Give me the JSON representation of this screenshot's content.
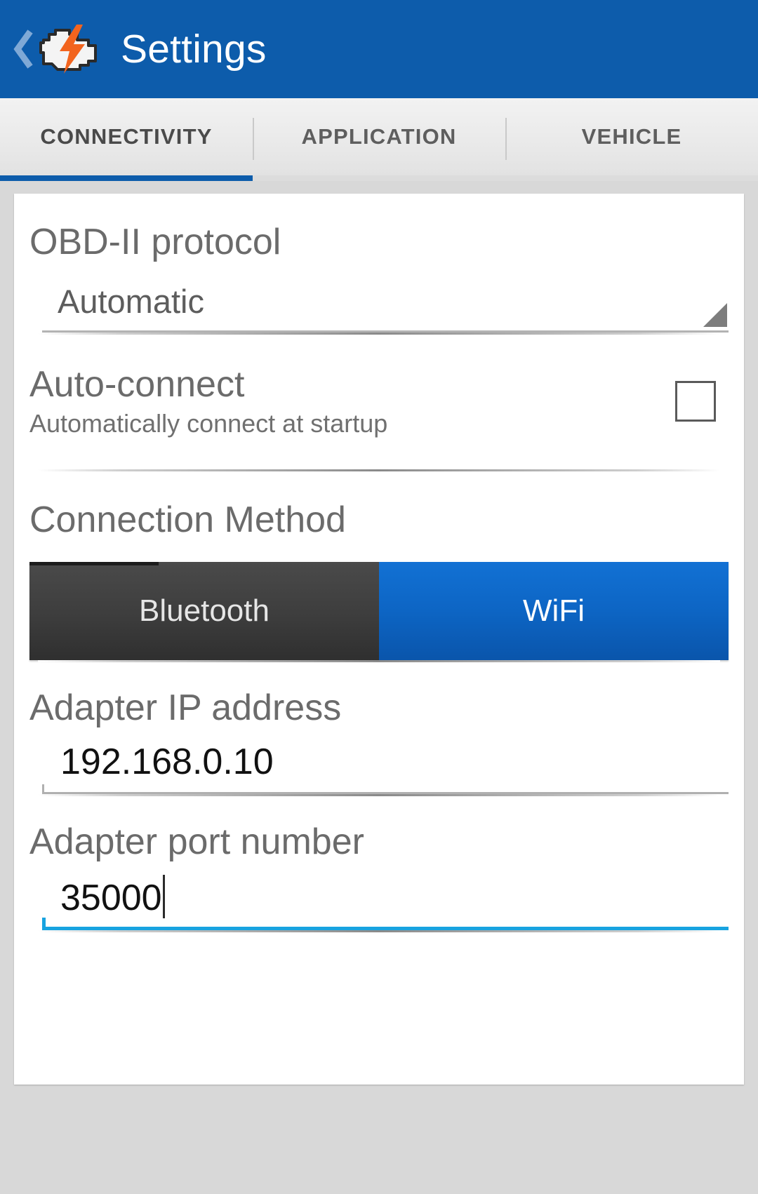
{
  "actionbar": {
    "title": "Settings",
    "back_icon": "back-chevron-icon",
    "app_icon": "engine-lightning-icon",
    "background_color": "#0d5cab"
  },
  "tabs": {
    "items": [
      {
        "label": "CONNECTIVITY",
        "active": true
      },
      {
        "label": "APPLICATION",
        "active": false
      },
      {
        "label": "VEHICLE",
        "active": false
      }
    ],
    "indicator_color": "#0d5cab"
  },
  "settings": {
    "protocol": {
      "title": "OBD-II protocol",
      "value": "Automatic"
    },
    "auto_connect": {
      "title": "Auto-connect",
      "summary": "Automatically connect at startup",
      "checked": false
    },
    "connection_method": {
      "title": "Connection Method",
      "options": [
        {
          "label": "Bluetooth",
          "selected": false
        },
        {
          "label": "WiFi",
          "selected": true
        }
      ],
      "selected_color": "#0d65c4",
      "unselected_color": "#3d3d3d"
    },
    "adapter_ip": {
      "title": "Adapter IP address",
      "value": "192.168.0.10",
      "focused": false
    },
    "adapter_port": {
      "title": "Adapter port number",
      "value": "35000",
      "focused": true,
      "focus_color": "#18a3e0"
    }
  }
}
